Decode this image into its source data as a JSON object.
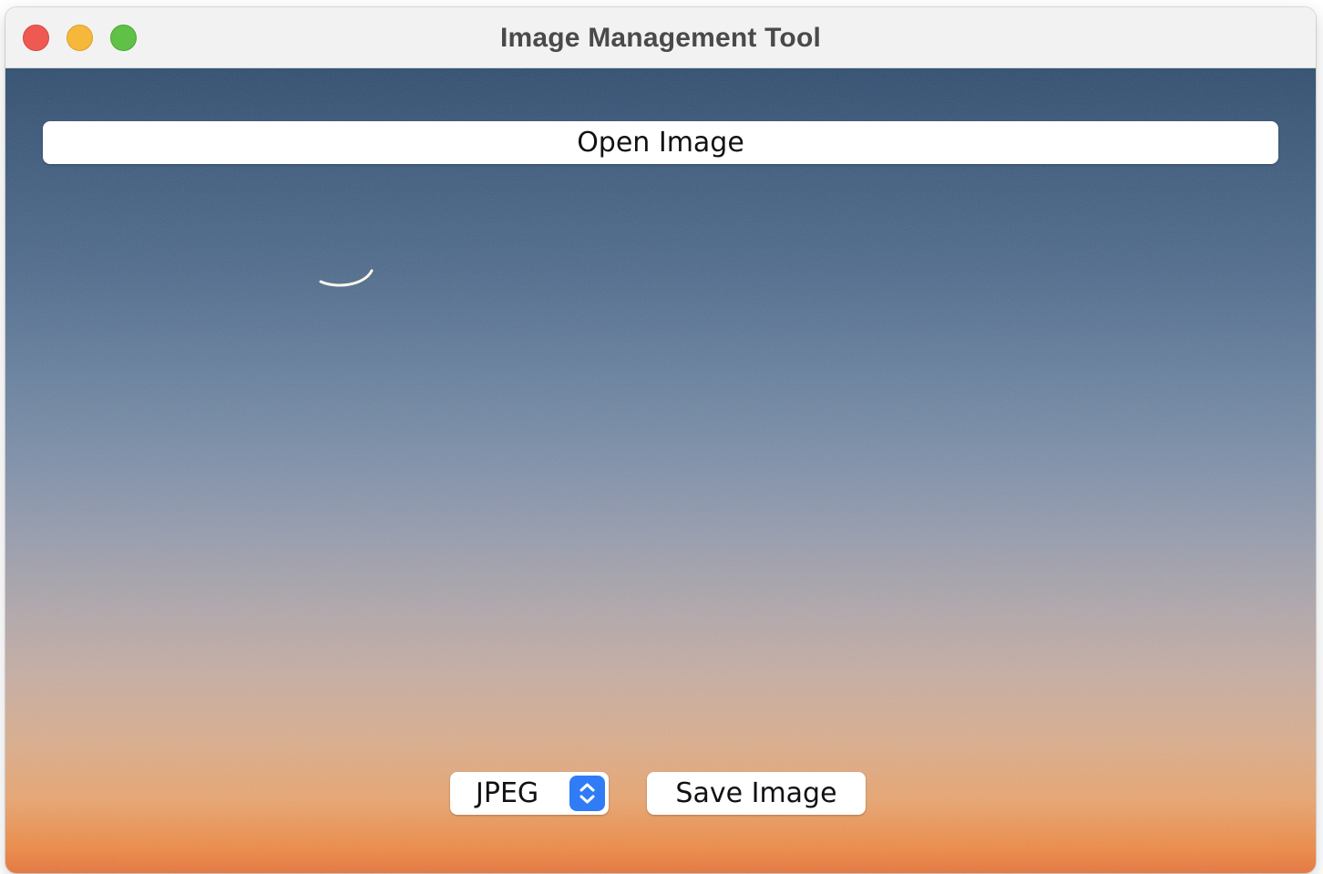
{
  "window": {
    "title": "Image Management Tool",
    "controls": {
      "close_icon": "close-icon",
      "minimize_icon": "minimize-icon",
      "maximize_icon": "maximize-icon"
    }
  },
  "toolbar": {
    "open_label": "Open Image"
  },
  "preview": {
    "image_subject": "twilight sky with crescent moon",
    "colors": {
      "sky_top": "#2f4c6f",
      "sky_middle": "#8191ab",
      "sky_bottom": "#e8743a"
    }
  },
  "format_select": {
    "selected": "JPEG",
    "icon": "chevron-up-down-icon",
    "accent": "#2f7cf6"
  },
  "actions": {
    "save_label": "Save Image"
  }
}
